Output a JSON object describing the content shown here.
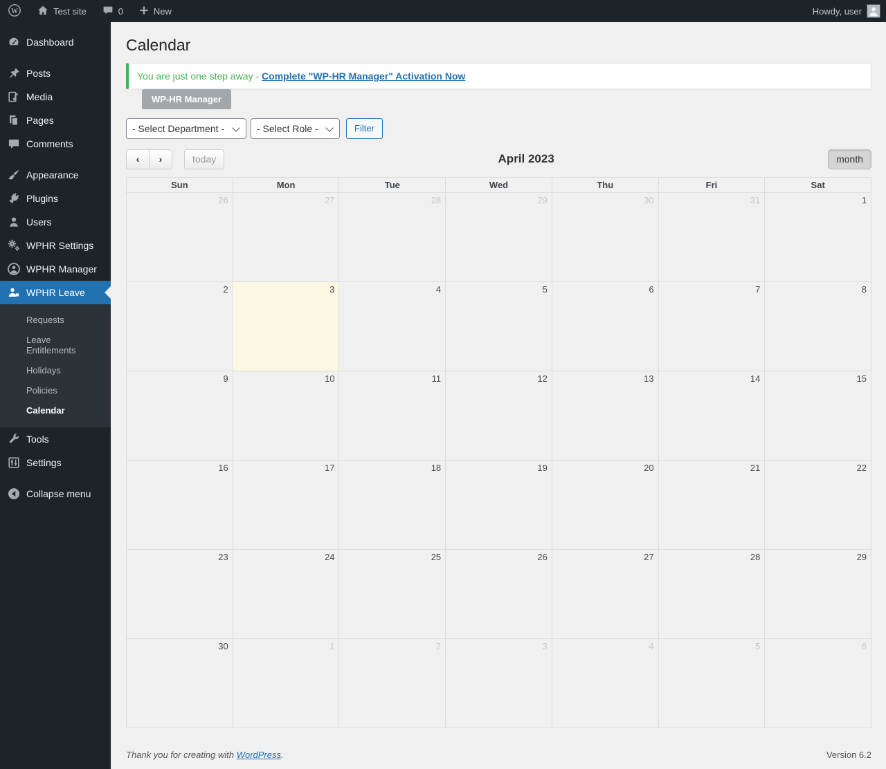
{
  "admin_bar": {
    "site_name": "Test site",
    "comments_count": "0",
    "new_label": "New",
    "howdy": "Howdy, user"
  },
  "sidebar": {
    "items": [
      {
        "label": "Dashboard"
      },
      {
        "label": "Posts"
      },
      {
        "label": "Media"
      },
      {
        "label": "Pages"
      },
      {
        "label": "Comments"
      },
      {
        "label": "Appearance"
      },
      {
        "label": "Plugins"
      },
      {
        "label": "Users"
      },
      {
        "label": "WPHR Settings"
      },
      {
        "label": "WPHR Manager"
      },
      {
        "label": "WPHR Leave"
      },
      {
        "label": "Tools"
      },
      {
        "label": "Settings"
      },
      {
        "label": "Collapse menu"
      }
    ],
    "leave_submenu": [
      "Requests",
      "Leave Entitlements",
      "Holidays",
      "Policies",
      "Calendar"
    ]
  },
  "page": {
    "title": "Calendar",
    "notice_text": "You are just one step away - ",
    "notice_link": "Complete \"WP-HR Manager\" Activation Now",
    "plugin_tab": "WP-HR Manager"
  },
  "filters": {
    "department_placeholder": "- Select Department -",
    "role_placeholder": "- Select Role -",
    "filter_button": "Filter"
  },
  "calendar": {
    "toolbar": {
      "prev": "‹",
      "next": "›",
      "today": "today",
      "title": "April 2023",
      "view": "month"
    },
    "day_headers": [
      "Sun",
      "Mon",
      "Tue",
      "Wed",
      "Thu",
      "Fri",
      "Sat"
    ],
    "weeks": [
      [
        {
          "d": 26,
          "muted": true
        },
        {
          "d": 27,
          "muted": true
        },
        {
          "d": 28,
          "muted": true
        },
        {
          "d": 29,
          "muted": true
        },
        {
          "d": 30,
          "muted": true
        },
        {
          "d": 31,
          "muted": true
        },
        {
          "d": 1
        }
      ],
      [
        {
          "d": 2
        },
        {
          "d": 3,
          "today": true
        },
        {
          "d": 4
        },
        {
          "d": 5
        },
        {
          "d": 6
        },
        {
          "d": 7
        },
        {
          "d": 8
        }
      ],
      [
        {
          "d": 9
        },
        {
          "d": 10
        },
        {
          "d": 11
        },
        {
          "d": 12
        },
        {
          "d": 13
        },
        {
          "d": 14
        },
        {
          "d": 15
        }
      ],
      [
        {
          "d": 16
        },
        {
          "d": 17
        },
        {
          "d": 18
        },
        {
          "d": 19
        },
        {
          "d": 20
        },
        {
          "d": 21
        },
        {
          "d": 22
        }
      ],
      [
        {
          "d": 23
        },
        {
          "d": 24
        },
        {
          "d": 25
        },
        {
          "d": 26
        },
        {
          "d": 27
        },
        {
          "d": 28
        },
        {
          "d": 29
        }
      ],
      [
        {
          "d": 30
        },
        {
          "d": 1,
          "muted": true
        },
        {
          "d": 2,
          "muted": true
        },
        {
          "d": 3,
          "muted": true
        },
        {
          "d": 4,
          "muted": true
        },
        {
          "d": 5,
          "muted": true
        },
        {
          "d": 6,
          "muted": true
        }
      ]
    ]
  },
  "footer": {
    "thanks_prefix": "Thank you for creating with ",
    "wordpress_link": "WordPress",
    "thanks_suffix": ".",
    "version": "Version 6.2"
  },
  "colors": {
    "accent_blue": "#2271b1",
    "success_green": "#46b450",
    "today_highlight": "#fcf8e3",
    "admin_dark": "#1d2327",
    "submenu_dark": "#2c3338"
  }
}
